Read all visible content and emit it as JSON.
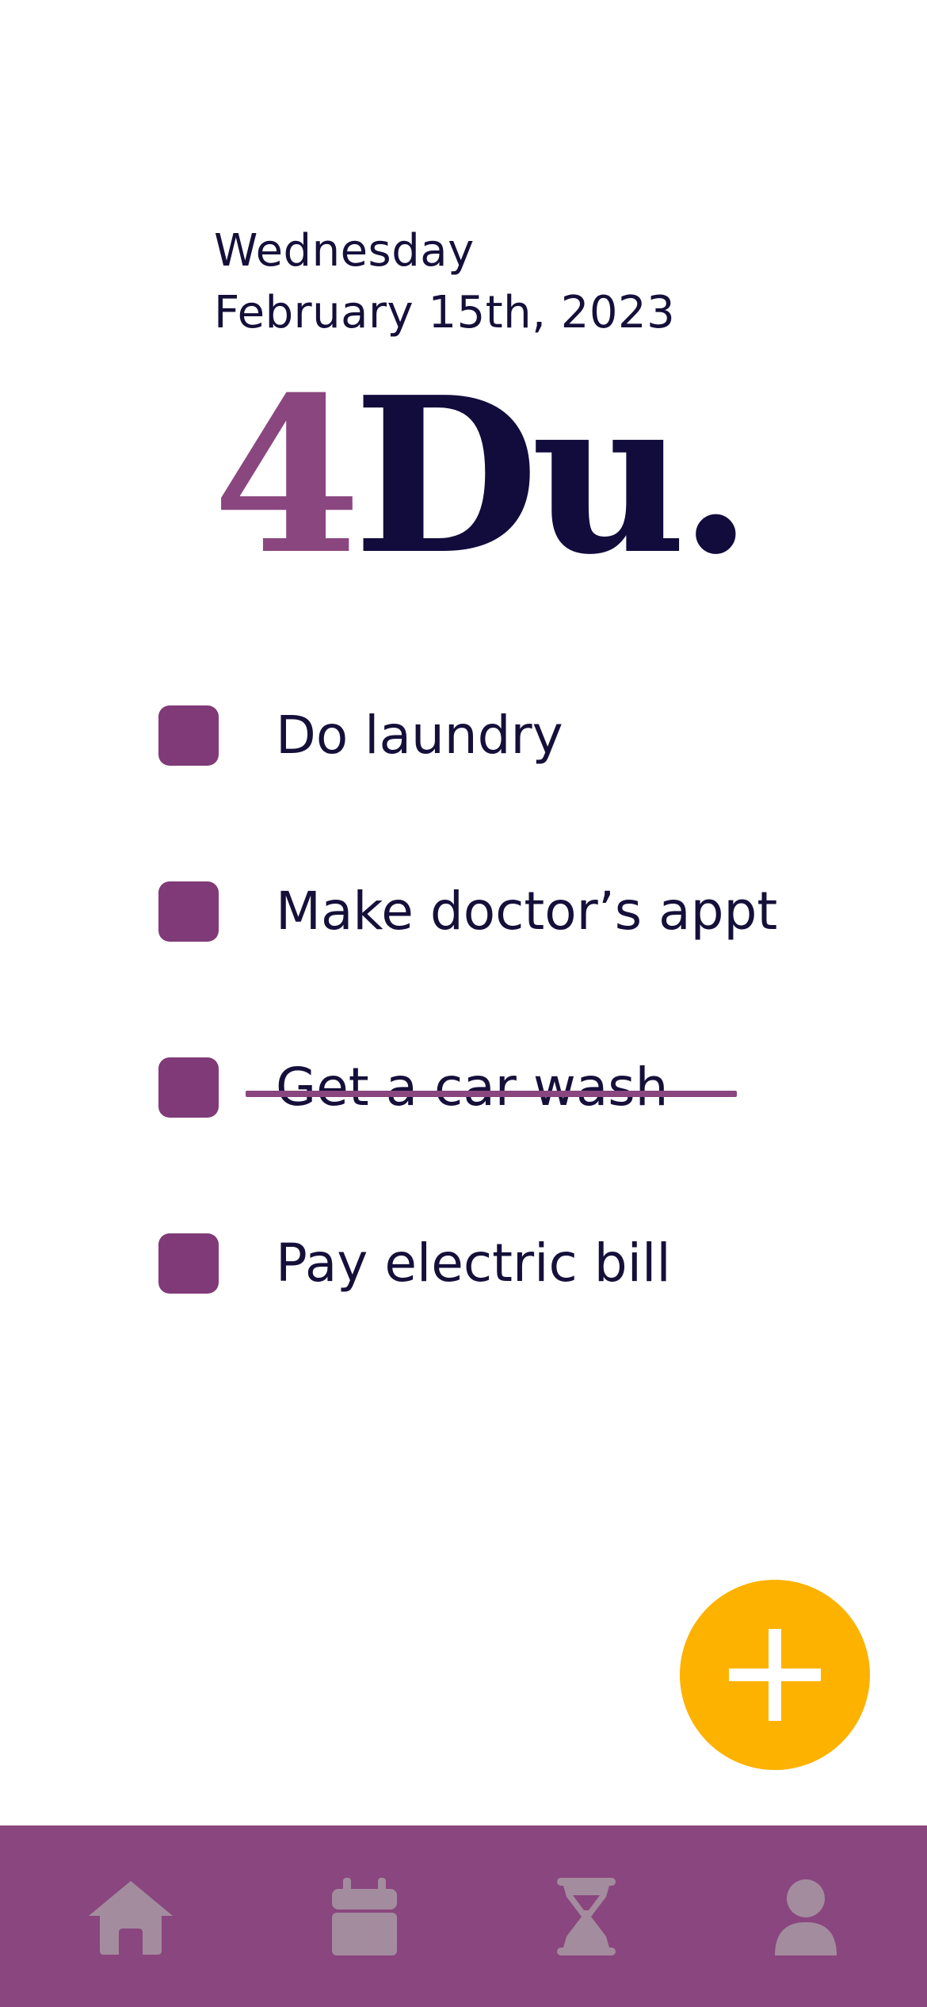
{
  "header": {
    "weekday": "Wednesday",
    "date": "February 15th, 2023"
  },
  "logo": {
    "number": "4",
    "word": "Du."
  },
  "todos": [
    {
      "label": "Do laundry",
      "completed": false
    },
    {
      "label": "Make doctor’s appt",
      "completed": false
    },
    {
      "label": "Get a car wash",
      "completed": true
    },
    {
      "label": "Pay electric bill",
      "completed": false
    }
  ],
  "fab": {
    "icon": "plus-icon"
  },
  "bottom_nav": {
    "items": [
      {
        "icon": "home-icon"
      },
      {
        "icon": "calendar-icon"
      },
      {
        "icon": "hourglass-icon"
      },
      {
        "icon": "user-icon"
      }
    ]
  },
  "colors": {
    "accent_purple": "#8a467e",
    "checkbox_purple": "#803a78",
    "text_dark": "#15103a",
    "fab_yellow": "#fdb200",
    "nav_icon_gray": "#a38c9e"
  }
}
